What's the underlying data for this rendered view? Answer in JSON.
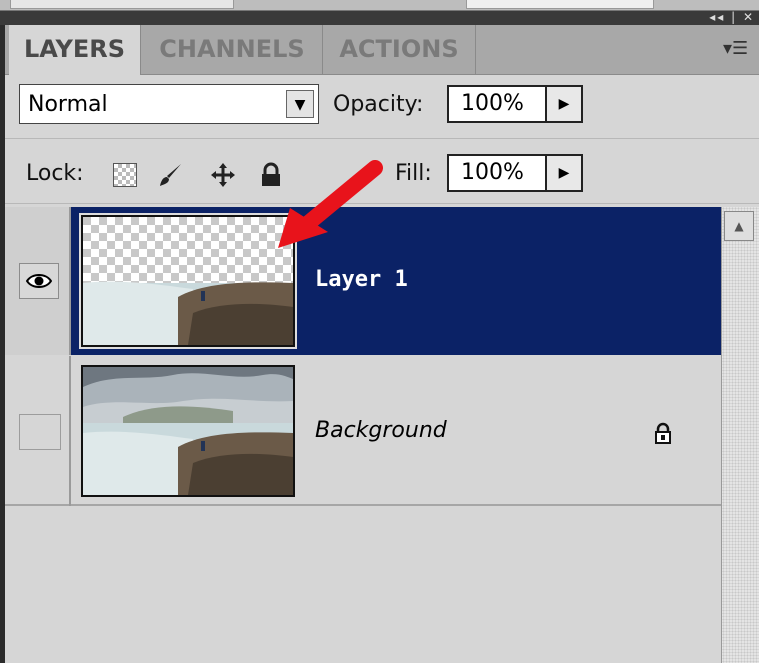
{
  "panel": {
    "tabs": [
      {
        "label": "LAYERS",
        "active": true
      },
      {
        "label": "CHANNELS",
        "active": false
      },
      {
        "label": "ACTIONS",
        "active": false
      }
    ],
    "menu_icon": "panel-menu-icon"
  },
  "blend": {
    "mode": "Normal",
    "dropdown_icon": "chevron-down-icon"
  },
  "opacity": {
    "label": "Opacity:",
    "value": "100%"
  },
  "lock": {
    "label": "Lock:",
    "icons": [
      "lock-transparent-pixels-icon",
      "brush-icon",
      "move-icon",
      "lock-icon"
    ]
  },
  "fill": {
    "label": "Fill:",
    "value": "100%"
  },
  "layers": [
    {
      "name": "Layer 1",
      "visible": true,
      "selected": true,
      "transparent_top": true
    },
    {
      "name": "Background",
      "visible": false,
      "selected": false,
      "locked": true
    }
  ],
  "colors": {
    "selected_row": "#0b2266",
    "arrow": "#e8131b"
  }
}
